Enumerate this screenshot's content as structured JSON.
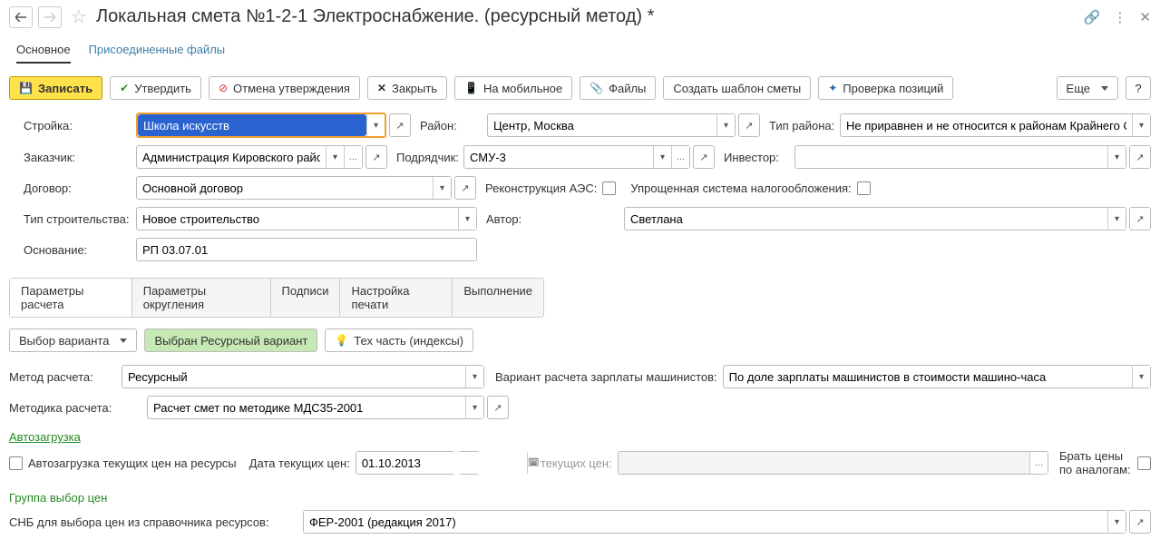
{
  "title": "Локальная смета №1-2-1 Электроснабжение. (ресурсный метод) *",
  "topTabs": {
    "main": "Основное",
    "files": "Присоединенные файлы"
  },
  "toolbar": {
    "save": "Записать",
    "approve": "Утвердить",
    "cancelApprove": "Отмена утверждения",
    "close": "Закрыть",
    "mobile": "На мобильное",
    "files": "Файлы",
    "template": "Создать шаблон сметы",
    "check": "Проверка позиций",
    "more": "Еще",
    "help": "?"
  },
  "labels": {
    "stroyka": "Стройка:",
    "rayon": "Район:",
    "tipRayona": "Тип района:",
    "zakazchik": "Заказчик:",
    "podryadchik": "Подрядчик:",
    "investor": "Инвестор:",
    "dogovor": "Договор:",
    "rekonstrAES": "Реконструкция АЭС:",
    "uproshNalog": "Упрощенная система налогообложения:",
    "tipStroit": "Тип строительства:",
    "avtor": "Автор:",
    "osnovanie": "Основание:"
  },
  "values": {
    "stroyka": "Школа искусств",
    "rayon": "Центр, Москва",
    "tipRayona": "Не приравнен и не относится к районам Крайнего С",
    "zakazchik": "Администрация Кировского района",
    "podryadchik": "СМУ-3",
    "investor": "",
    "dogovor": "Основной договор",
    "tipStroit": "Новое строительство",
    "avtor": "Светлана",
    "osnovanie": "РП 03.07.01"
  },
  "sectionTabs": {
    "calc": "Параметры расчета",
    "round": "Параметры округления",
    "sign": "Подписи",
    "print": "Настройка печати",
    "exec": "Выполнение"
  },
  "sub": {
    "choose": "Выбор варианта",
    "chosen": "Выбран Ресурсный вариант",
    "tech": "Тех часть (индексы)"
  },
  "calc": {
    "methodLbl": "Метод расчета:",
    "methodVal": "Ресурсный",
    "variantLbl": "Вариант расчета зарплаты машинистов:",
    "variantVal": "По доле зарплаты машинистов в стоимости машино-часа",
    "metodikaLbl": "Методика расчета:",
    "metodikaVal": "Расчет смет по методике МДС35-2001"
  },
  "auto": {
    "heading": "Автозагрузка",
    "chkLbl": "Автозагрузка текущих цен на ресурсы",
    "dateLbl": "Дата текущих цен:",
    "dateVal": "01.10.2013",
    "sbornikLbl": "Сборник текущих цен:",
    "analogLbl": "Брать цены по аналогам:"
  },
  "group": {
    "heading": "Группа выбор цен",
    "snbLbl": "СНБ для выбора цен из справочника ресурсов:",
    "snbVal": "ФЕР-2001 (редакция 2017)"
  }
}
